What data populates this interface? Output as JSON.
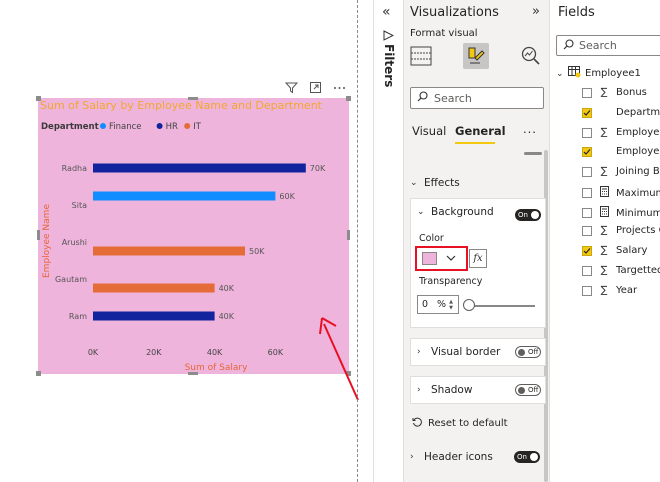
{
  "visual": {
    "background": "#efb4dc",
    "header_icons": [
      "filter-icon",
      "focus-mode-icon",
      "more-options-icon"
    ]
  },
  "chart_data": {
    "type": "bar",
    "orientation": "horizontal",
    "title": "Sum of Salary by Employee Name and Department",
    "xlabel": "Sum of Salary",
    "ylabel": "Employee Name",
    "legend_title": "Department",
    "legend_position": "top-left",
    "series": [
      {
        "name": "Finance",
        "color": "#118dff"
      },
      {
        "name": "HR",
        "color": "#12239e"
      },
      {
        "name": "IT",
        "color": "#e66c37"
      }
    ],
    "categories": [
      "Radha",
      "Sita",
      "Arushi",
      "Gautam",
      "Ram"
    ],
    "bars": [
      {
        "category": "Radha",
        "series": "HR",
        "value": 70000,
        "label": "70K"
      },
      {
        "category": "Sita",
        "series": "Finance",
        "value": 60000,
        "label": "60K"
      },
      {
        "category": "Arushi",
        "series": "IT",
        "value": 50000,
        "label": "50K"
      },
      {
        "category": "Gautam",
        "series": "IT",
        "value": 40000,
        "label": "40K"
      },
      {
        "category": "Ram",
        "series": "HR",
        "value": 40000,
        "label": "40K"
      }
    ],
    "x_ticks": [
      {
        "value": 0,
        "label": "0K"
      },
      {
        "value": 20000,
        "label": "20K"
      },
      {
        "value": 40000,
        "label": "40K"
      },
      {
        "value": 60000,
        "label": "60K"
      }
    ],
    "xlim": [
      0,
      75000
    ],
    "grid": false
  },
  "filters": {
    "label": "Filters"
  },
  "visualizations": {
    "title": "Visualizations",
    "format_visual": "Format visual",
    "search_placeholder": "Search",
    "tabs": {
      "visual": "Visual",
      "general": "General",
      "more": "..."
    },
    "effects": "Effects",
    "background": {
      "title": "Background",
      "toggle": "On",
      "color_label": "Color",
      "color_value": "#efb4dc",
      "fx": "fx",
      "transparency_label": "Transparency",
      "transparency_value": "0",
      "transparency_unit": "%"
    },
    "visual_border": {
      "title": "Visual border",
      "toggle": "Off"
    },
    "shadow": {
      "title": "Shadow",
      "toggle": "Off"
    },
    "reset": "Reset to default",
    "header_icons": {
      "title": "Header icons",
      "toggle": "On"
    }
  },
  "fields": {
    "title": "Fields",
    "search_placeholder": "Search",
    "table": "Employee1",
    "items": [
      {
        "label": "Bonus",
        "icon": "sigma-icon",
        "checked": false
      },
      {
        "label": "Department",
        "icon": "none",
        "checked": true
      },
      {
        "label": "Employee ID",
        "icon": "sigma-icon",
        "checked": false
      },
      {
        "label": "Employee Name",
        "icon": "none",
        "checked": true
      },
      {
        "label": "Joining Bonus",
        "icon": "sigma-icon",
        "checked": false
      },
      {
        "label": "Maximum Bonus",
        "icon": "calculator-icon",
        "checked": false
      },
      {
        "label": "Minimum Bonus",
        "icon": "calculator-icon",
        "checked": false
      },
      {
        "label": "Projects Completed",
        "icon": "sigma-icon",
        "checked": false
      },
      {
        "label": "Salary",
        "icon": "sigma-icon",
        "checked": true
      },
      {
        "label": "Targetted Projects",
        "icon": "sigma-icon",
        "checked": false
      },
      {
        "label": "Year",
        "icon": "sigma-icon",
        "checked": false
      }
    ]
  }
}
